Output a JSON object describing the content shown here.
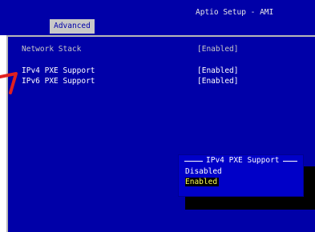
{
  "header": {
    "title": "Aptio Setup - AMI",
    "tab": "Advanced"
  },
  "settings": [
    {
      "label": "Network Stack",
      "value": "[Enabled]"
    },
    {
      "label": "IPv4 PXE Support",
      "value": "[Enabled]"
    },
    {
      "label": "IPv6 PXE Support",
      "value": "[Enabled]"
    }
  ],
  "popup": {
    "title": "IPv4 PXE Support",
    "options": [
      "Disabled",
      "Enabled"
    ],
    "selected": "Enabled"
  },
  "colors": {
    "background": "#0000a8",
    "tab": "#c8c8c8",
    "highlight_text": "#ffff55",
    "annotation_arrow": "#e02020"
  }
}
